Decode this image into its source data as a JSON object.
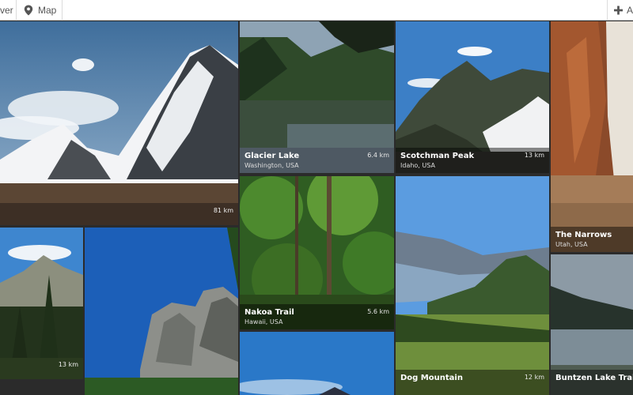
{
  "toolbar": {
    "left_label": "ver",
    "map_label": "Map",
    "add_label": "A"
  },
  "tiles": [
    {
      "name": "",
      "location": "",
      "distance": "81 km"
    },
    {
      "name": "Glacier Lake",
      "location": "Washington, USA",
      "distance": "6.4 km"
    },
    {
      "name": "Scotchman Peak",
      "location": "Idaho, USA",
      "distance": "13 km"
    },
    {
      "name": "The Narrows",
      "location": "Utah, USA",
      "distance": ""
    },
    {
      "name": "",
      "location": "",
      "distance": "13 km"
    },
    {
      "name": "Nakoa Trail",
      "location": "Hawaii, USA",
      "distance": "5.6 km"
    },
    {
      "name": "Dog Mountain",
      "location": "",
      "distance": "12 km"
    },
    {
      "name": "Buntzen Lake Trail",
      "location": "",
      "distance": ""
    }
  ]
}
